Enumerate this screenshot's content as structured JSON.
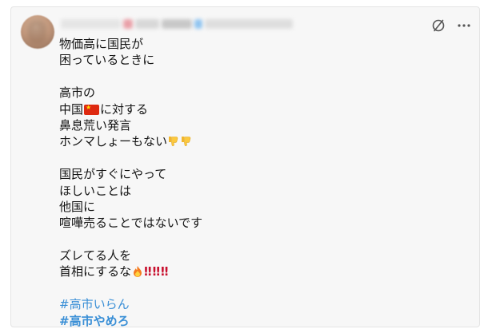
{
  "post": {
    "author_blurred": true,
    "lines": [
      "物価高に国民が",
      "困っているときに",
      "",
      "高市の",
      "中国",
      "に対する",
      "鼻息荒い発言",
      "ホンマしょーもない",
      "",
      "国民がすぐにやって",
      "ほしいことは",
      "他国に",
      "喧嘩売ることではないです",
      "",
      "ズレてる人を",
      "首相にするな",
      "",
      "#高市いらん",
      "#高市やめろ"
    ],
    "hashtags": [
      "#高市いらん",
      "#高市やめろ"
    ],
    "emphasis_marks": [
      "‼",
      "‼",
      "‼"
    ]
  },
  "icons": {
    "grok": "slash-circle-icon",
    "more": "more-dots-icon"
  },
  "colors": {
    "background": "#f7f7f7",
    "text": "#141414",
    "hashtag": "#3a8fd6",
    "bang": "#c8102e",
    "flag": "#de2910"
  }
}
